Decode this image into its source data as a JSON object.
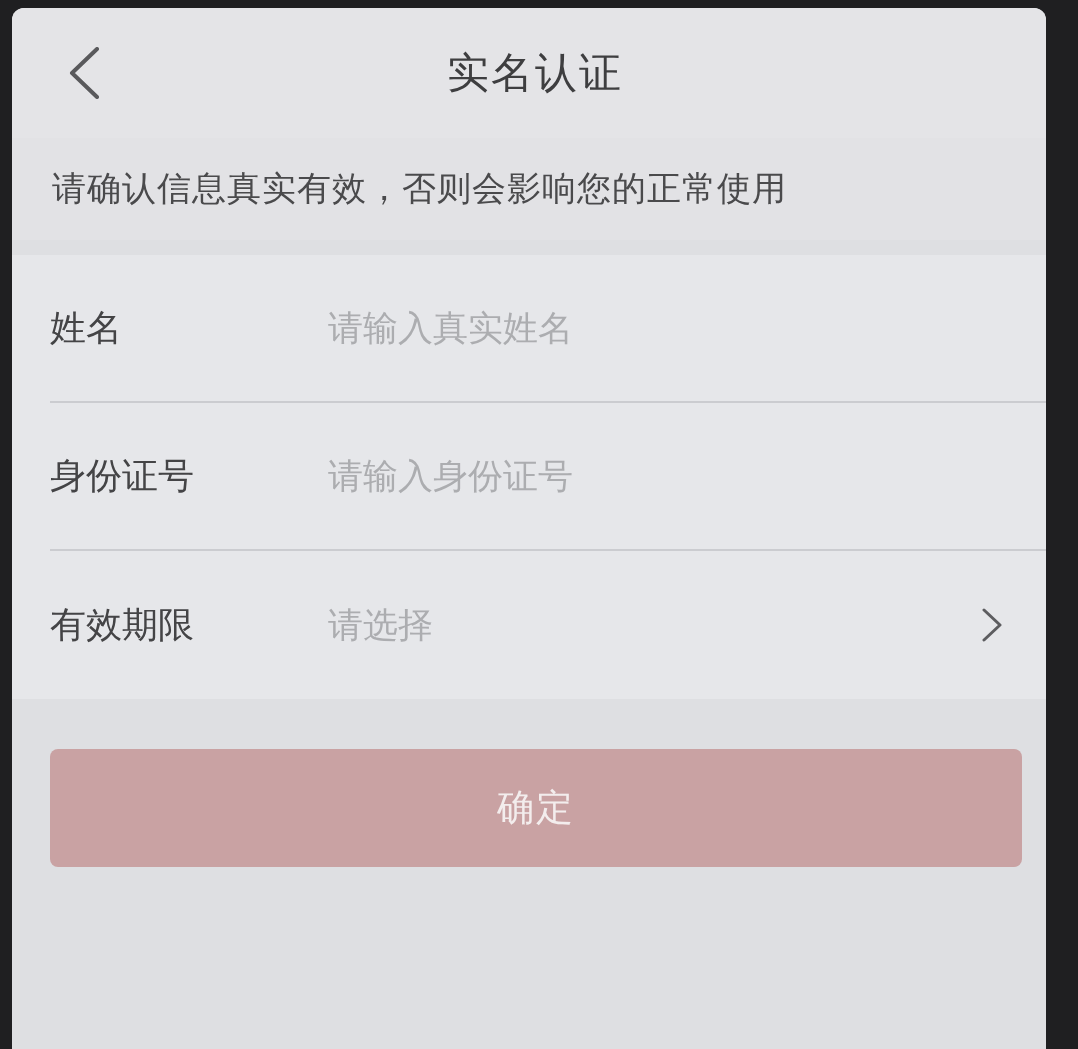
{
  "nav": {
    "title": "实名认证"
  },
  "notice": "请确认信息真实有效，否则会影响您的正常使用",
  "fields": [
    {
      "kind": "input",
      "label": "姓名",
      "placeholder": "请输入真实姓名"
    },
    {
      "kind": "input",
      "label": "身份证号",
      "placeholder": "请输入身份证号"
    },
    {
      "kind": "select",
      "label": "有效期限",
      "placeholder": "请选择"
    }
  ],
  "submit": {
    "label": "确定",
    "disabled": true
  }
}
